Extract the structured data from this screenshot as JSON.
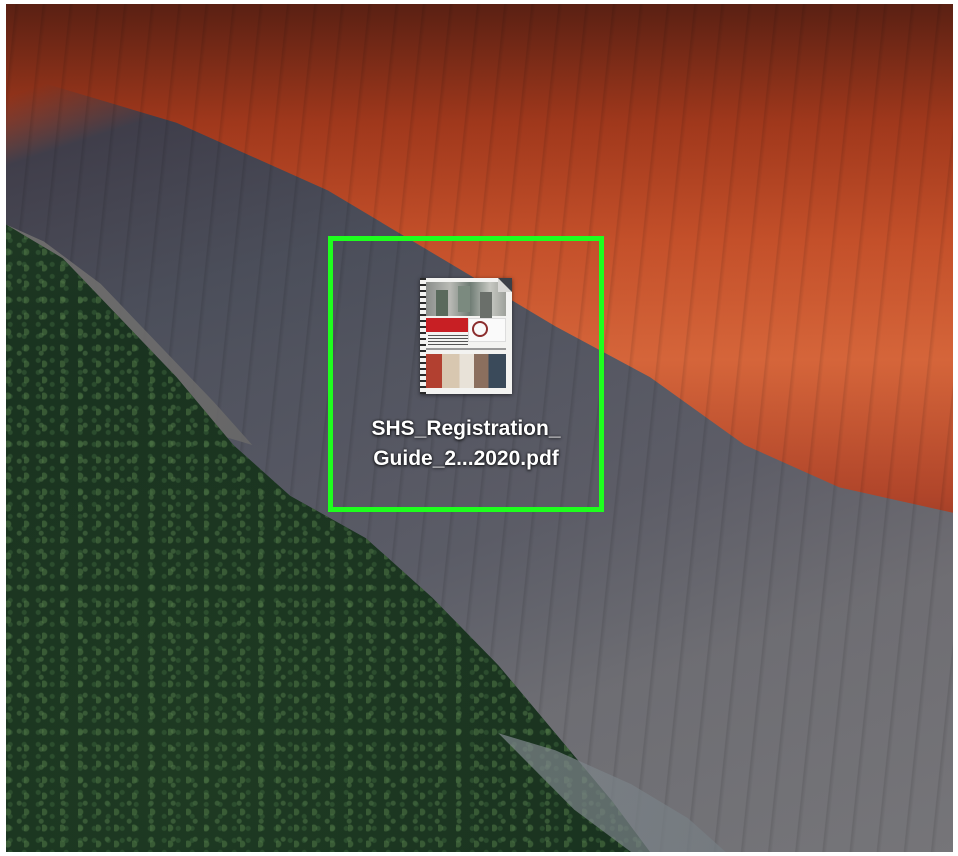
{
  "desktop": {
    "wallpaper": "mountain-cliff-sunset",
    "selection_color": "#1eff1e",
    "file": {
      "name_line1": "SHS_Registration_",
      "name_line2": "Guide_2...2020.pdf",
      "icon": "pdf-document-icon"
    }
  }
}
